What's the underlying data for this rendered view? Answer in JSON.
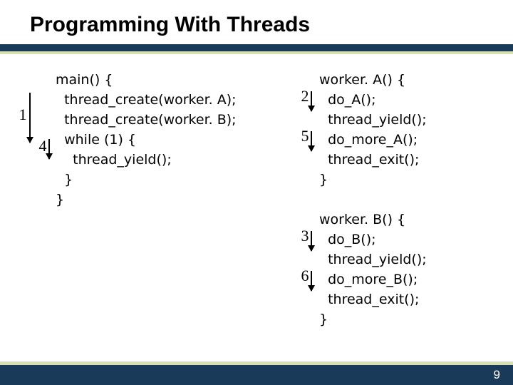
{
  "title": "Programming With Threads",
  "page_number": "9",
  "code": {
    "main": "main() {\n  thread_create(worker. A);\n  thread_create(worker. B);\n  while (1) {\n    thread_yield();\n  }\n}",
    "workerA": "worker. A() {\n  do_A();\n  thread_yield();\n  do_more_A();\n  thread_exit();\n}",
    "workerB": "worker. B() {\n  do_B();\n  thread_yield();\n  do_more_B();\n  thread_exit();\n}"
  },
  "steps": {
    "s1": "1",
    "s4": "4",
    "s2": "2",
    "s5": "5",
    "s3": "3",
    "s6": "6"
  }
}
